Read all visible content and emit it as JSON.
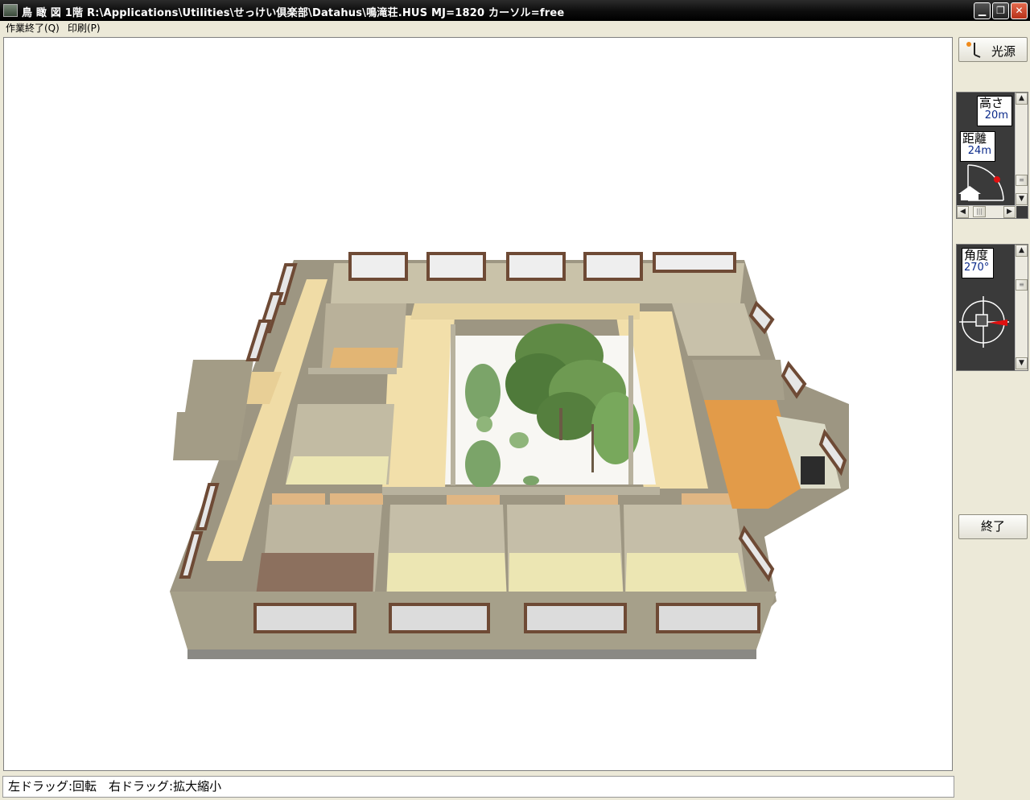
{
  "window": {
    "title": "鳥 瞰 図  1階  R:\\Applications\\Utilities\\せっけい倶楽部\\Datahus\\鳴滝荘.HUS  MJ=1820  カーソル=free",
    "minimize_glyph": "▁",
    "maximize_glyph": "❐",
    "close_glyph": "✕"
  },
  "menu": {
    "items": [
      {
        "label": "作業終了(Q)"
      },
      {
        "label": "印刷(P)"
      }
    ]
  },
  "right_panel": {
    "light_button": {
      "label": "光源",
      "icon": "lamp-icon"
    },
    "camera": {
      "height_label": "高さ",
      "height_value": "20m",
      "distance_label": "距離",
      "distance_value": "24m",
      "icons": [
        "house-icon",
        "camera-position-marker"
      ]
    },
    "angle": {
      "label": "角度",
      "value": "270°",
      "icons": [
        "compass-crosshair-icon"
      ]
    },
    "end_button": {
      "label": "終了"
    }
  },
  "statusbar": {
    "text": "左ドラッグ:回転　右ドラッグ:拡大縮小"
  },
  "colors": {
    "titlebar": "#000000",
    "panel_bg": "#3a3a3a",
    "viewport_bg": "#ffffff",
    "wall": "#a29b83",
    "floor_wood": "#f2dfaa",
    "tatami": "#ebe6b4",
    "window_frame": "#6e4a35",
    "close_button": "#c8452a"
  }
}
